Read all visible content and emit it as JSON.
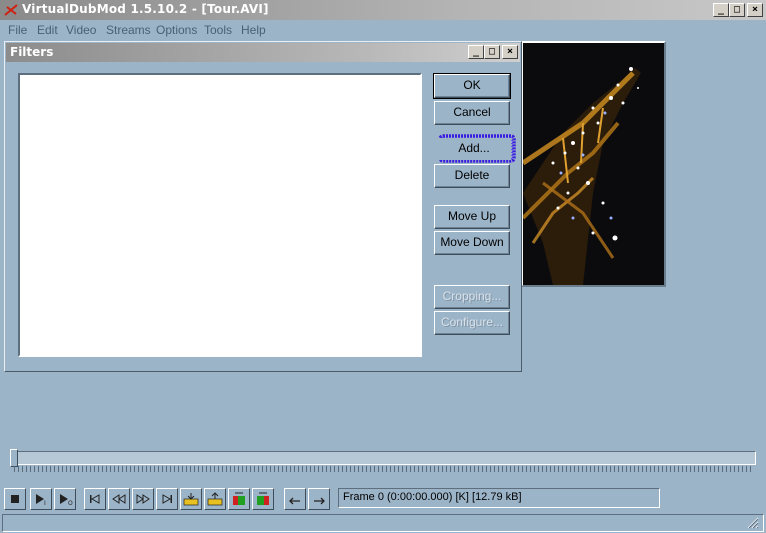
{
  "window": {
    "title": "VirtualDubMod 1.5.10.2 - [Tour.AVI]",
    "controls": {
      "minimize": "_",
      "maximize": "□",
      "close": "×"
    }
  },
  "menu": [
    "File",
    "Edit",
    "Video",
    "Streams",
    "Options",
    "Tools",
    "Help"
  ],
  "dialog": {
    "title": "Filters",
    "filters": [],
    "buttons": {
      "ok": "OK",
      "cancel": "Cancel",
      "add": "Add...",
      "delete": "Delete",
      "move_up": "Move Up",
      "move_down": "Move Down",
      "cropping": "Cropping...",
      "configure": "Configure..."
    }
  },
  "timeline": {
    "position": 0
  },
  "toolbar": {
    "icons": [
      "stop-icon",
      "play-input-icon",
      "play-output-icon",
      "go-start-icon",
      "step-back-icon",
      "step-forward-icon",
      "go-end-icon",
      "prev-keyframe-icon",
      "next-keyframe-icon",
      "scene-back-icon",
      "scene-forward-icon",
      "mark-in-icon",
      "mark-out-icon"
    ]
  },
  "status": {
    "frame_text": "Frame 0 (0:00:00.000) [K] [12.79 kB]"
  },
  "colors": {
    "background": "#9cb4c8",
    "highlight_scribble": "#3a1ee0"
  }
}
